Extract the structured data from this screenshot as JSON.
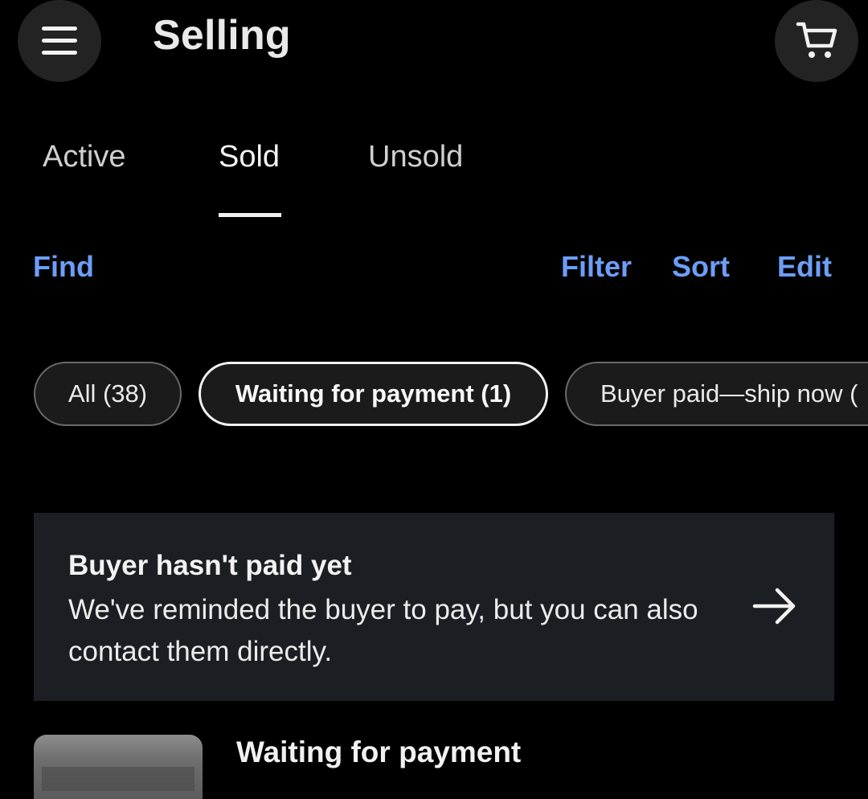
{
  "header": {
    "title": "Selling",
    "menu_icon": "hamburger-menu-icon",
    "cart_icon": "shopping-cart-icon"
  },
  "tabs": [
    {
      "label": "Active",
      "selected": false
    },
    {
      "label": "Sold",
      "selected": true
    },
    {
      "label": "Unsold",
      "selected": false
    }
  ],
  "actions": {
    "find": "Find",
    "filter": "Filter",
    "sort": "Sort",
    "edit": "Edit"
  },
  "chips": [
    {
      "label": "All (38)",
      "selected": false
    },
    {
      "label": "Waiting for payment (1)",
      "selected": true
    },
    {
      "label": "Buyer paid—ship now (",
      "selected": false
    }
  ],
  "banner": {
    "title": "Buyer hasn't paid yet",
    "body": "We've reminded the buyer to pay, but you can also contact them directly.",
    "arrow_icon": "arrow-right-icon"
  },
  "listing": {
    "status": "Waiting for payment"
  },
  "colors": {
    "background": "#000000",
    "accent": "#6d9ef7",
    "banner_bg": "#1b1f24",
    "chip_bg": "#1b1b1b"
  }
}
